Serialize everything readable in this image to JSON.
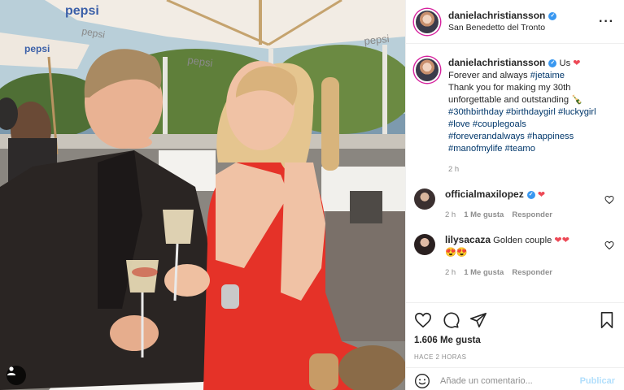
{
  "post": {
    "author": "danielachristiansson",
    "location": "San Benedetto del Tronto",
    "more_icon": "more-options-icon",
    "tag_icon": "tagged-user-icon",
    "photo_signage": [
      "pepsi",
      "pepsi",
      "pepsi",
      "pepsi",
      "pepsi"
    ]
  },
  "caption": {
    "username": "danielachristiansson",
    "after_badge": "Us",
    "heart": "❤",
    "line1_text": "Forever and always",
    "line1_tag": "#jetaime",
    "line2": "Thank you for making my 30th",
    "line3": "unforgettable and outstanding",
    "line3_emoji": "🍾",
    "tags": [
      [
        "#30thbirthday",
        "#birthdaygirl",
        "#luckygirl"
      ],
      [
        "#love",
        "#couplegoals"
      ],
      [
        "#foreverandalways",
        "#happiness"
      ],
      [
        "#manofmylife",
        "#teamo"
      ]
    ],
    "time": "2 h"
  },
  "comments": [
    {
      "username": "officialmaxilopez",
      "text": "",
      "heart": "❤",
      "time": "2 h",
      "likes": "1 Me gusta",
      "reply": "Responder"
    },
    {
      "username": "lilysacaza",
      "text": "Golden couple",
      "heart": "❤❤",
      "emoji": "😍😍",
      "time": "2 h",
      "likes": "1 Me gusta",
      "reply": "Responder"
    }
  ],
  "actions": {
    "like_icon": "heart-icon",
    "comment_icon": "comment-icon",
    "share_icon": "share-icon",
    "save_icon": "bookmark-icon",
    "likes_text": "1.606 Me gusta",
    "ago_text": "HACE 2 HORAS"
  },
  "add_comment": {
    "emoji_icon": "emoji-icon",
    "placeholder": "Añade un comentario...",
    "publish_label": "Publicar"
  }
}
